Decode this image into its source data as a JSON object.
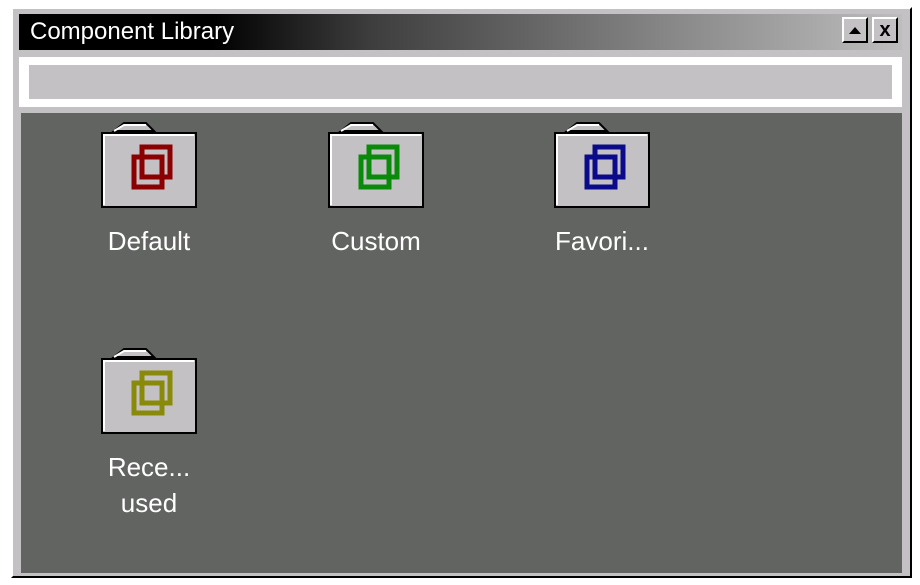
{
  "window": {
    "title": "Component Library",
    "buttons": {
      "maximize_icon": "triangle-up-icon",
      "close_label": "x"
    }
  },
  "search": {
    "value": "",
    "placeholder": ""
  },
  "folders": [
    {
      "label": "Default",
      "color": "#8b0000"
    },
    {
      "label": "Custom",
      "color": "#0a8a0a"
    },
    {
      "label": "Favori...",
      "color": "#0a0a8a"
    },
    {
      "label": "Rece...\nused",
      "color": "#8a8a0a"
    }
  ],
  "colors": {
    "window_bg": "#c4c1c4",
    "content_bg": "#626462",
    "folder_body": "#c4c1c4"
  }
}
